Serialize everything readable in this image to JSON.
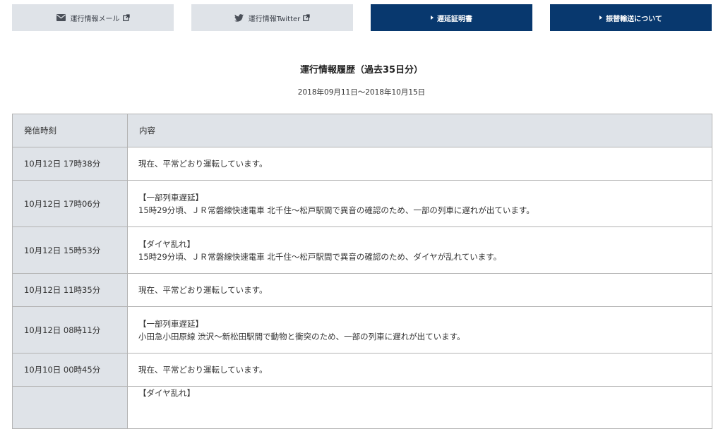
{
  "topnav": [
    {
      "label": "運行情報メール",
      "style": "light",
      "icon": "envelope-icon",
      "external": true
    },
    {
      "label": "運行情報Twitter",
      "style": "light",
      "icon": "twitter-bird-icon",
      "external": true
    },
    {
      "label": "遅延証明書",
      "style": "dark",
      "icon": "triangle-right-icon",
      "external": false
    },
    {
      "label": "振替輸送について",
      "style": "dark",
      "icon": "triangle-right-icon",
      "external": false
    }
  ],
  "history": {
    "heading": "運行情報履歴（過去35日分）",
    "period": "2018年09月11日～2018年10月15日",
    "columns": [
      "発信時刻",
      "内容"
    ],
    "rows": [
      {
        "time": "10月12日 17時38分",
        "title": "",
        "body": "現在、平常どおり運転しています。"
      },
      {
        "time": "10月12日 17時06分",
        "title": "【一部列車遅延】",
        "body": "15時29分頃、ＪＲ常磐線快速電車 北千住～松戸駅間で異音の確認のため、一部の列車に遅れが出ています。"
      },
      {
        "time": "10月12日 15時53分",
        "title": "【ダイヤ乱れ】",
        "body": "15時29分頃、ＪＲ常磐線快速電車 北千住～松戸駅間で異音の確認のため、ダイヤが乱れています。"
      },
      {
        "time": "10月12日 11時35分",
        "title": "",
        "body": "現在、平常どおり運転しています。"
      },
      {
        "time": "10月12日 08時11分",
        "title": "【一部列車遅延】",
        "body": "小田急小田原線 渋沢～新松田駅間で動物と衝突のため、一部の列車に遅れが出ています。"
      },
      {
        "time": "10月10日 00時45分",
        "title": "",
        "body": "現在、平常どおり運転しています。"
      },
      {
        "time": "",
        "title": "【ダイヤ乱れ】",
        "body": ""
      }
    ]
  },
  "colors": {
    "light_bg": "#dfe3e8",
    "dark_bg": "#08386e",
    "border": "#b3b3b3"
  }
}
